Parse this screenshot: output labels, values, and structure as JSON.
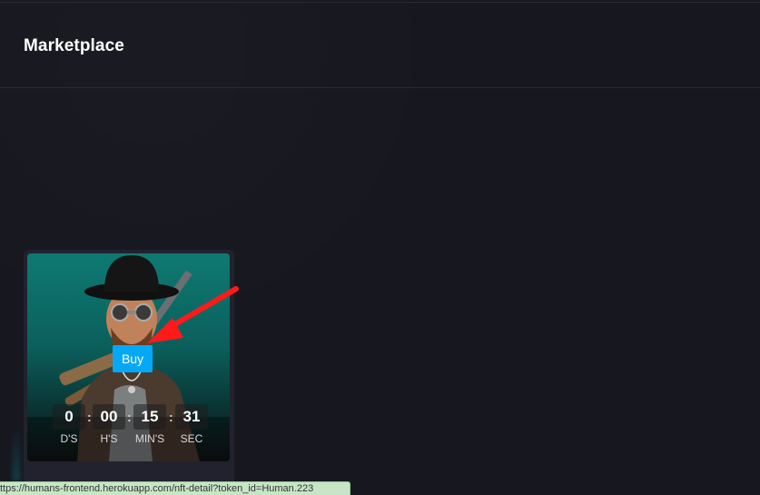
{
  "header": {
    "title": "Marketplace"
  },
  "card": {
    "buy_label": "Buy",
    "countdown": [
      {
        "value": "0",
        "label": "D'S"
      },
      {
        "value": "00",
        "label": "H'S"
      },
      {
        "value": "15",
        "label": "MIN'S"
      },
      {
        "value": "31",
        "label": "SEC"
      }
    ],
    "separator": ":"
  },
  "status_bar": {
    "url": "ttps://humans-frontend.herokuapp.com/nft-detail?token_id=Human.223"
  },
  "colors": {
    "background": "#17171f",
    "card": "#22222e",
    "buy_button": "#05a8f5",
    "annotation_arrow": "#ff1a1a"
  }
}
